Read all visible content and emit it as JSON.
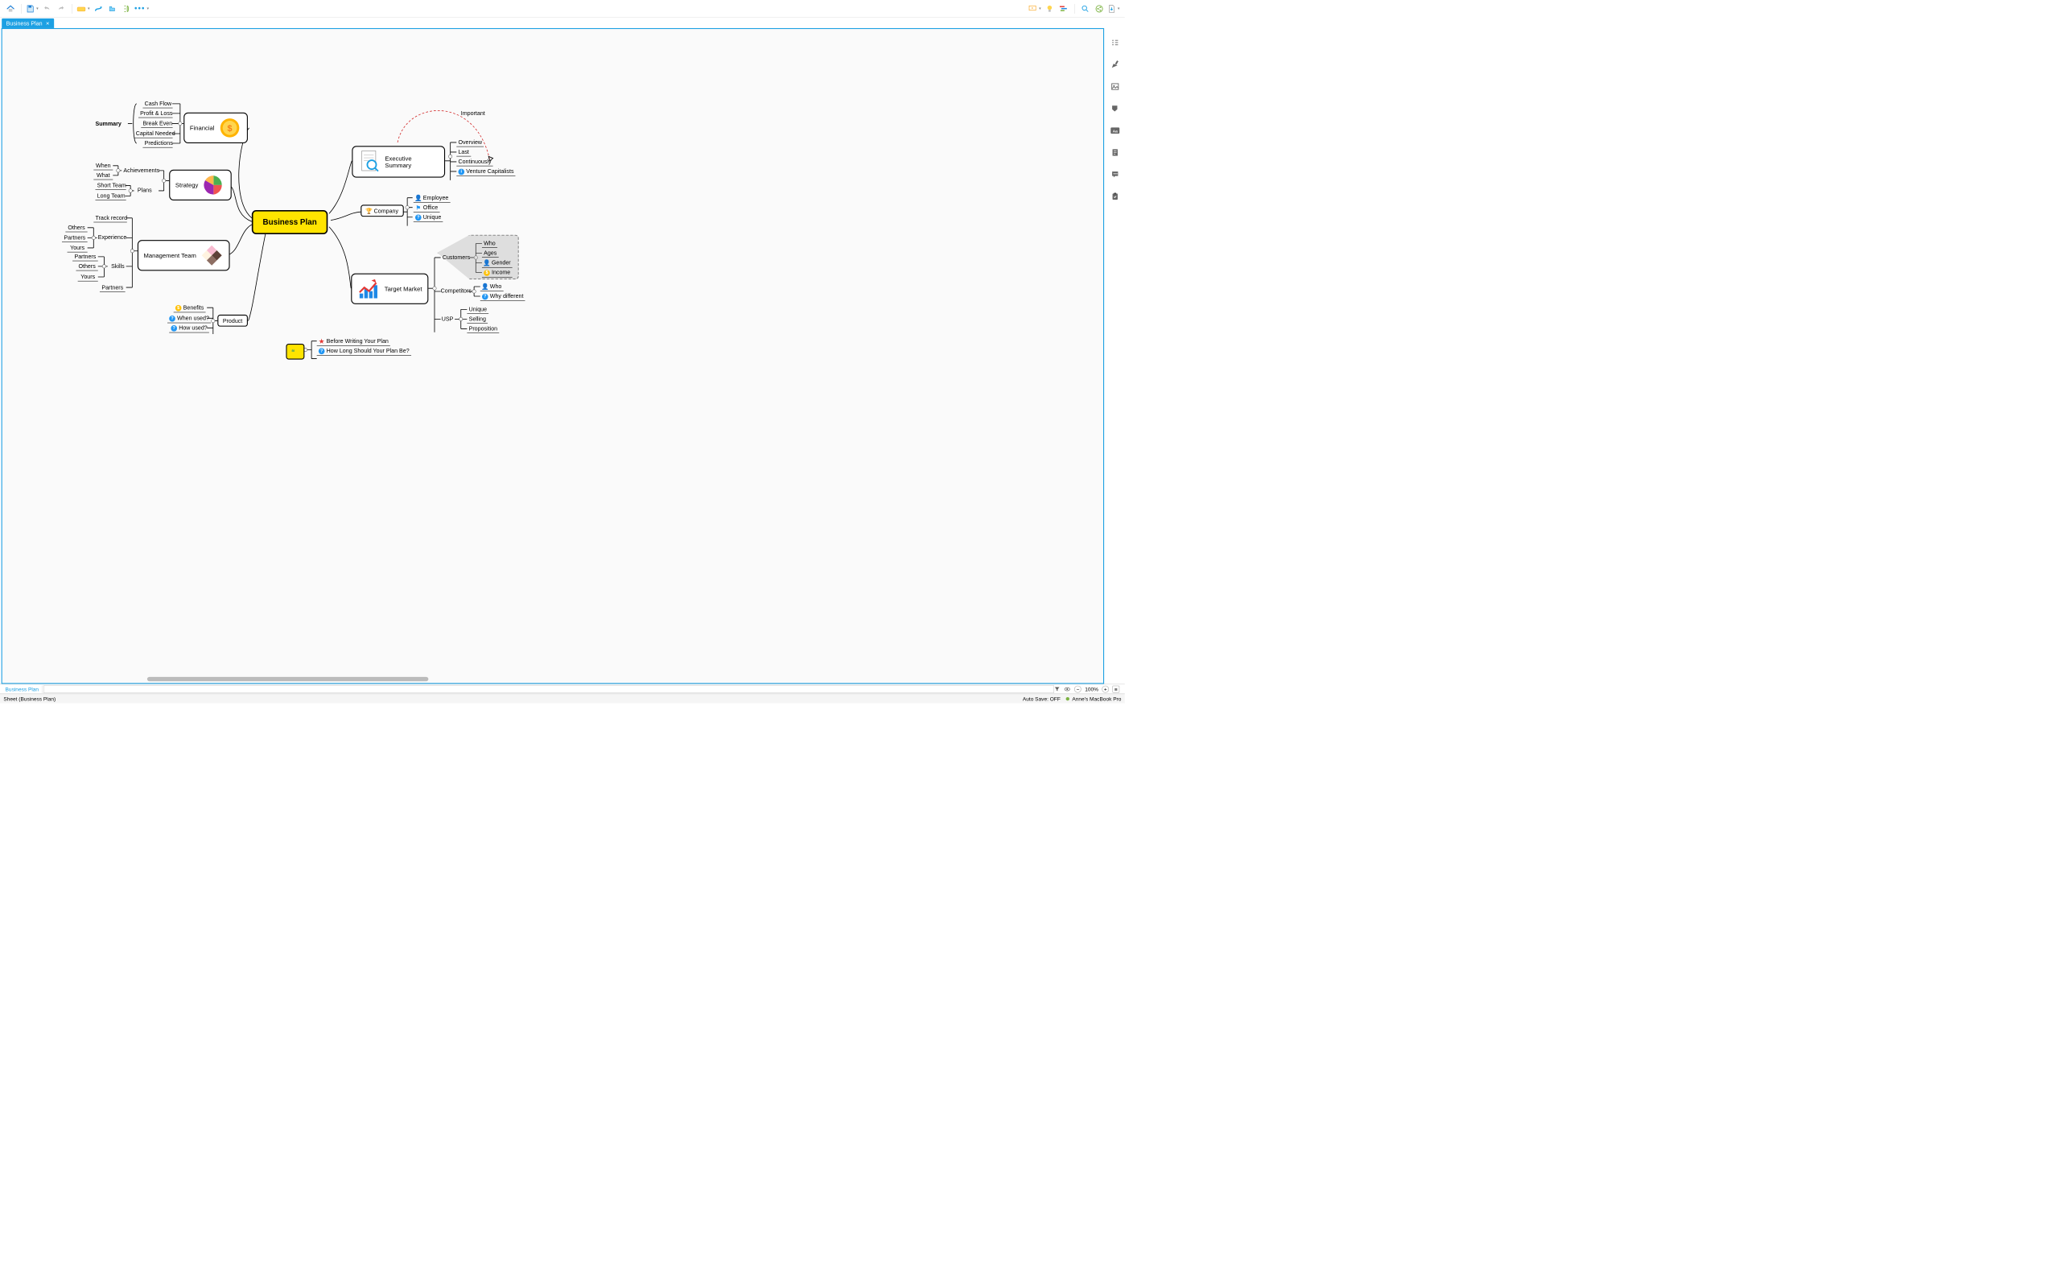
{
  "tab": {
    "title": "Business Plan"
  },
  "sheet": {
    "name": "Business Plan"
  },
  "status": {
    "left": "Sheet (Business Plan)",
    "autosave": "Auto Save: OFF",
    "device": "Anne's MacBook Pro"
  },
  "zoom": {
    "value": "100%"
  },
  "mindmap": {
    "center": "Business Plan",
    "financial": {
      "label": "Financial",
      "summary_label": "Summary",
      "items": [
        "Cash Flow",
        "Profit & Loss",
        "Break Even",
        "Capital Needed",
        "Predictions"
      ]
    },
    "strategy": {
      "label": "Strategy",
      "achievements": {
        "label": "Achievements",
        "items": [
          "When",
          "What"
        ]
      },
      "plans": {
        "label": "Plans",
        "items": [
          "Short Team",
          "Long Team"
        ]
      }
    },
    "management": {
      "label": "Management Team",
      "track": "Track record",
      "experience": {
        "label": "Experience",
        "items": [
          "Others",
          "Partners",
          "Yours"
        ]
      },
      "skills": {
        "label": "Skills",
        "items": [
          "Partners",
          "Others",
          "Yours"
        ]
      },
      "partners": "Partners"
    },
    "product": {
      "label": "Product",
      "items": [
        "Benefits",
        "When used?",
        "How used?"
      ]
    },
    "exec": {
      "label": "Executive Summary",
      "items": [
        "Overview",
        "Last",
        "Continuously",
        "Venture Capitalists"
      ],
      "relation": "Important"
    },
    "company": {
      "label": "Company",
      "items": [
        "Employee",
        "Office",
        "Unique"
      ]
    },
    "target": {
      "label": "Target Market",
      "customers": {
        "label": "Customers",
        "items": [
          "Who",
          "Ages",
          "Gender",
          "Income"
        ]
      },
      "competitors": {
        "label": "Competitors",
        "items": [
          "Who",
          "Why different"
        ]
      },
      "usp": {
        "label": "USP",
        "items": [
          "Unique",
          "Selling",
          "Proposition"
        ]
      }
    },
    "floating": {
      "items": [
        "Before Writing Your Plan",
        "How Long Should Your Plan Be?"
      ]
    }
  }
}
